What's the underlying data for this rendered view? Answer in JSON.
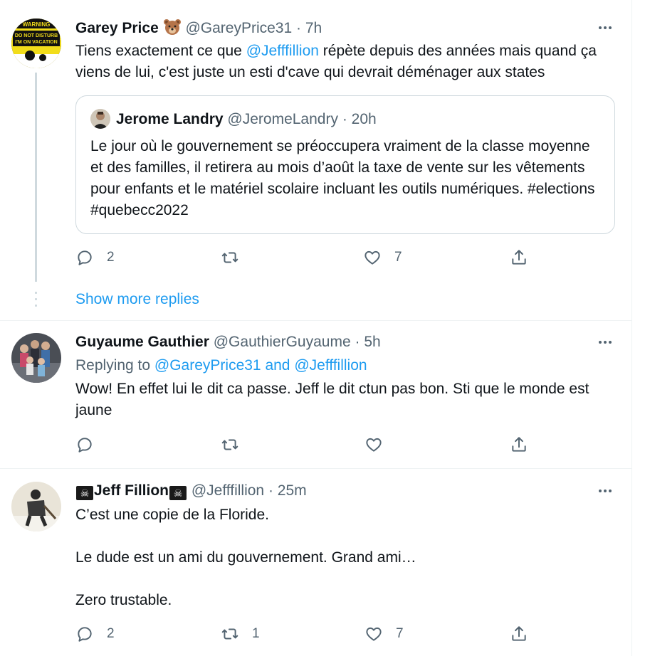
{
  "tweets": [
    {
      "name": "Garey Price",
      "emoji": "🐻",
      "handle": "@GareyPrice31",
      "time": "· 7h",
      "text_before": "Tiens exactement ce que ",
      "mention": "@Jefffillion",
      "text_after": " répète depuis des années mais quand ça viens de lui, c'est juste un esti d'cave qui devrait déménager aux states",
      "avatar_sign": {
        "line1": "WARNING",
        "line2": "DO NOT DISTURB",
        "line3": "I'M ON VACATION"
      },
      "quote": {
        "name": "Jerome Landry",
        "handle": "@JeromeLandry",
        "time": "· 20h",
        "text": "Le jour où le gouvernement se préoccupera vraiment de la classe moyenne et des familles, il retirera au mois d’août la taxe de vente sur les vêtements pour enfants et le matériel scolaire incluant les outils numériques. #elections #quebecc2022"
      },
      "actions": {
        "replies": "2",
        "retweets": "",
        "likes": "7"
      }
    },
    {
      "name": "Guyaume Gauthier",
      "handle": "@GauthierGuyaume",
      "time": "· 5h",
      "replying_prefix": "Replying to ",
      "replying_users": "@GareyPrice31 and @Jefffillion",
      "text": "Wow! En effet lui le dit ca passe. Jeff le dit ctun pas bon. Sti que le monde est jaune",
      "actions": {
        "replies": "",
        "retweets": "",
        "likes": ""
      }
    },
    {
      "name": "Jeff Fillion",
      "name_prefix_emoji": "☠",
      "name_suffix_emoji": "☠",
      "handle": "@Jefffillion",
      "time": "· 25m",
      "text": "C’est une copie de la Floride.\n\nLe dude est un ami du gouvernement. Grand ami…\n\nZero trustable.",
      "actions": {
        "replies": "2",
        "retweets": "1",
        "likes": "7"
      }
    }
  ],
  "show_more_replies": "Show more replies",
  "colors": {
    "accent": "#1d9bf0",
    "secondary_text": "#536471",
    "border": "#cfd9de"
  }
}
